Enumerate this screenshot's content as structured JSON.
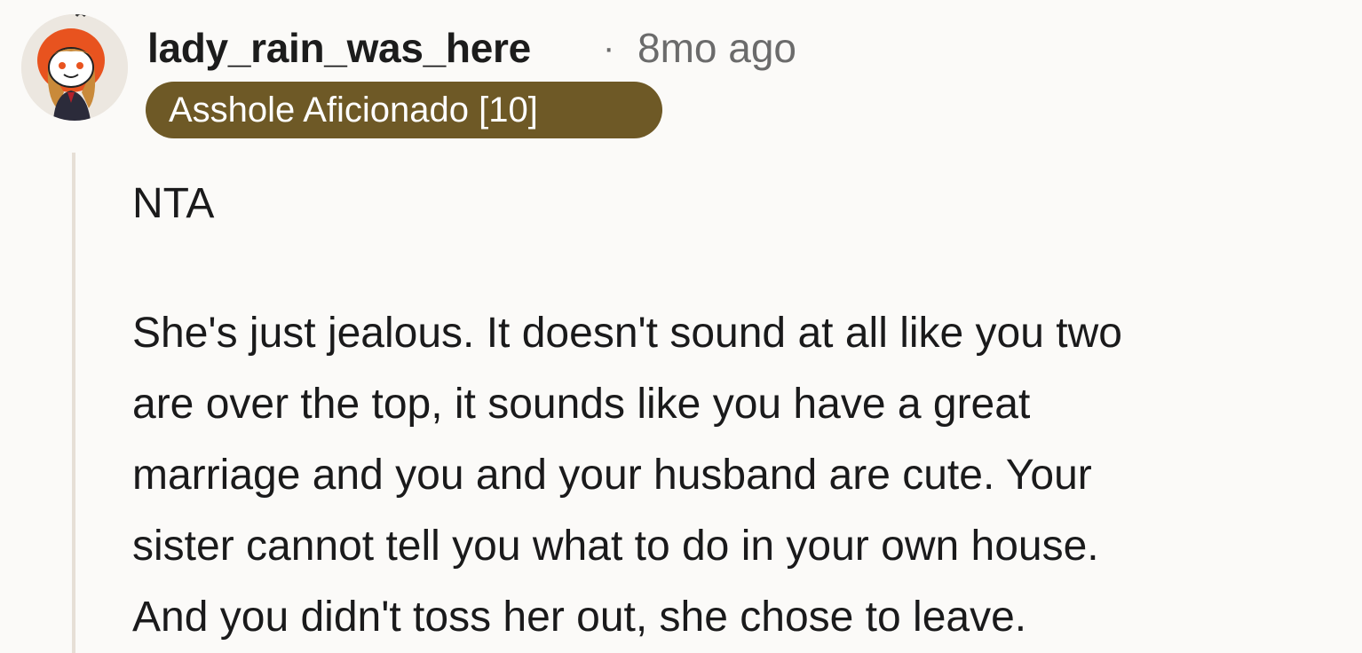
{
  "comment": {
    "username": "lady_rain_was_here",
    "separator": "·",
    "timestamp": "8mo ago",
    "flair": "Asshole Aficionado [10]",
    "avatar_icon": "snoo-avatar-icon",
    "verdict": "NTA",
    "body_lines": [
      "She's just jealous. It doesn't sound at all like you two",
      "are over the top, it sounds like you have a great",
      "marriage and you and your husband are cute. Your",
      "sister cannot tell you what to do in your own house.",
      "And you didn't toss her out, she chose to leave."
    ]
  },
  "colors": {
    "background": "#fbfaf8",
    "flair_background": "#6e5926",
    "flair_text": "#ffffff",
    "meta_text": "#6b6b6b",
    "thread_line": "#e6dfd6"
  }
}
